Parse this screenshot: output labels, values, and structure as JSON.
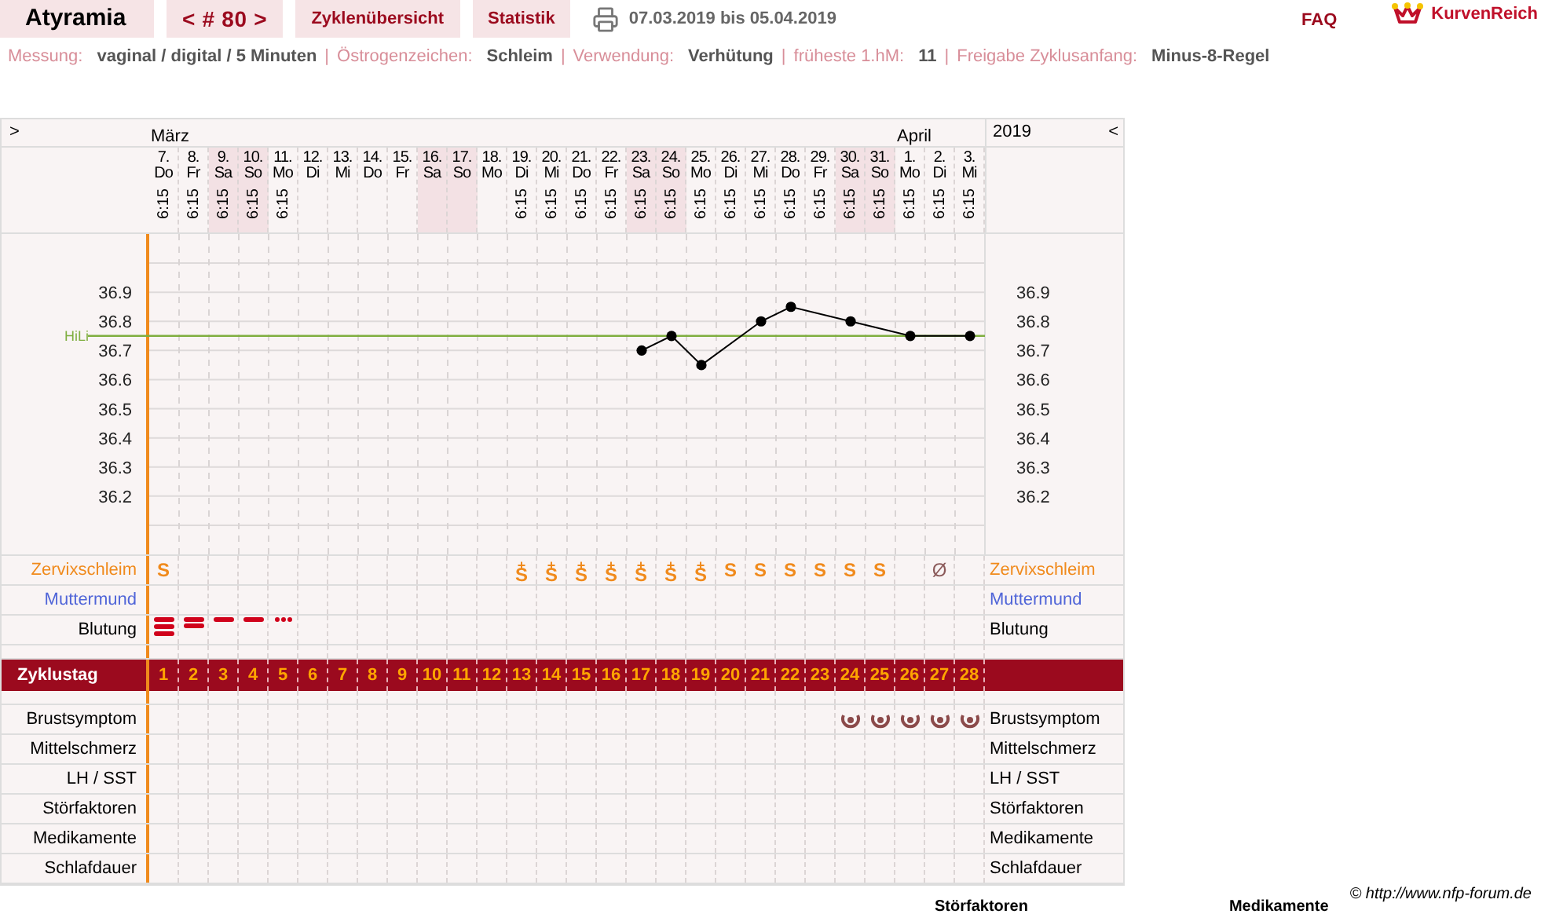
{
  "topbar": {
    "tabs": [
      {
        "label": "Atyramia",
        "kind": "title"
      },
      {
        "label": "< # 80 >",
        "kind": "nav"
      },
      {
        "label": "Zyklenübersicht",
        "kind": "link"
      },
      {
        "label": "Statistik",
        "kind": "link"
      }
    ],
    "date_range": "07.03.2019 bis 05.04.2019",
    "faq": "FAQ",
    "logo": "KurvenReich"
  },
  "info": [
    {
      "label": "Messung:",
      "value": "vaginal / digital / 5 Minuten"
    },
    {
      "separator": "|",
      "label": "Östrogenzeichen:",
      "value": "Schleim"
    },
    {
      "separator": "|",
      "label": "Verwendung:",
      "value": "Verhütung"
    },
    {
      "separator": "|",
      "label": "früheste 1.hM:",
      "value": "11"
    },
    {
      "separator": "|",
      "label": "Freigabe Zyklusanfang:",
      "value": "Minus-8-Regel"
    }
  ],
  "grid": {
    "expand_left": ">",
    "collapse_right": "<",
    "year": "2019",
    "days": [
      {
        "date": "7.",
        "weekday": "Do",
        "month": "März",
        "time": "6:15",
        "weekend": false,
        "cycle_day": "1",
        "mucus": "S",
        "bleeding": {
          "kind": "heavy"
        },
        "breast": false
      },
      {
        "date": "8.",
        "weekday": "Fr",
        "time": "6:15",
        "weekend": false,
        "cycle_day": "2",
        "bleeding": {
          "kind": "strong"
        },
        "breast": false
      },
      {
        "date": "9.",
        "weekday": "Sa",
        "time": "6:15",
        "weekend": true,
        "cycle_day": "3",
        "bleeding": {
          "kind": "medium"
        },
        "breast": false
      },
      {
        "date": "10.",
        "weekday": "So",
        "time": "6:15",
        "weekend": true,
        "cycle_day": "4",
        "bleeding": {
          "kind": "medium"
        },
        "breast": false
      },
      {
        "date": "11.",
        "weekday": "Mo",
        "time": "6:15",
        "weekend": false,
        "cycle_day": "5",
        "bleeding": {
          "kind": "spotting"
        },
        "breast": false
      },
      {
        "date": "12.",
        "weekday": "Di",
        "weekend": false,
        "cycle_day": "6",
        "breast": false
      },
      {
        "date": "13.",
        "weekday": "Mi",
        "weekend": false,
        "cycle_day": "7",
        "breast": false
      },
      {
        "date": "14.",
        "weekday": "Do",
        "weekend": false,
        "cycle_day": "8",
        "breast": false
      },
      {
        "date": "15.",
        "weekday": "Fr",
        "weekend": false,
        "cycle_day": "9",
        "breast": false
      },
      {
        "date": "16.",
        "weekday": "Sa",
        "weekend": true,
        "cycle_day": "10",
        "breast": false
      },
      {
        "date": "17.",
        "weekday": "So",
        "weekend": true,
        "cycle_day": "11",
        "breast": false
      },
      {
        "date": "18.",
        "weekday": "Mo",
        "weekend": false,
        "cycle_day": "12",
        "breast": false
      },
      {
        "date": "19.",
        "weekday": "Di",
        "time": "6:15",
        "weekend": false,
        "cycle_day": "13",
        "mucus": "S",
        "mucus_plus": "+",
        "breast": false
      },
      {
        "date": "20.",
        "weekday": "Mi",
        "time": "6:15",
        "weekend": false,
        "cycle_day": "14",
        "mucus": "S",
        "mucus_plus": "+",
        "breast": false
      },
      {
        "date": "21.",
        "weekday": "Do",
        "time": "6:15",
        "weekend": false,
        "cycle_day": "15",
        "mucus": "S",
        "mucus_plus": "+",
        "breast": false
      },
      {
        "date": "22.",
        "weekday": "Fr",
        "time": "6:15",
        "weekend": false,
        "cycle_day": "16",
        "mucus": "S",
        "mucus_plus": "+",
        "breast": false
      },
      {
        "date": "23.",
        "weekday": "Sa",
        "time": "6:15",
        "weekend": true,
        "cycle_day": "17",
        "mucus": "S",
        "mucus_plus": "+",
        "breast": false
      },
      {
        "date": "24.",
        "weekday": "So",
        "time": "6:15",
        "weekend": true,
        "cycle_day": "18",
        "mucus": "S",
        "mucus_plus": "+",
        "breast": false
      },
      {
        "date": "25.",
        "weekday": "Mo",
        "time": "6:15",
        "weekend": false,
        "cycle_day": "19",
        "mucus": "S",
        "mucus_plus": "+",
        "breast": false
      },
      {
        "date": "26.",
        "weekday": "Di",
        "time": "6:15",
        "weekend": false,
        "cycle_day": "20",
        "mucus": "S",
        "breast": false
      },
      {
        "date": "27.",
        "weekday": "Mi",
        "time": "6:15",
        "weekend": false,
        "cycle_day": "21",
        "mucus": "S",
        "breast": false
      },
      {
        "date": "28.",
        "weekday": "Do",
        "time": "6:15",
        "weekend": false,
        "cycle_day": "22",
        "mucus": "S",
        "breast": false
      },
      {
        "date": "29.",
        "weekday": "Fr",
        "time": "6:15",
        "weekend": false,
        "cycle_day": "23",
        "mucus": "S",
        "breast": false
      },
      {
        "date": "30.",
        "weekday": "Sa",
        "time": "6:15",
        "weekend": true,
        "cycle_day": "24",
        "mucus": "S",
        "breast": true
      },
      {
        "date": "31.",
        "weekday": "So",
        "time": "6:15",
        "weekend": true,
        "cycle_day": "25",
        "mucus": "S",
        "breast": true
      },
      {
        "date": "1.",
        "weekday": "Mo",
        "month": "April",
        "time": "6:15",
        "weekend": false,
        "cycle_day": "26",
        "breast": true
      },
      {
        "date": "2.",
        "weekday": "Di",
        "time": "6:15",
        "weekend": false,
        "cycle_day": "27",
        "mucus": "Ø",
        "breast": true
      },
      {
        "date": "3.",
        "weekday": "Mi",
        "time": "6:15",
        "weekend": false,
        "cycle_day": "28",
        "breast": true
      }
    ],
    "chart_data": {
      "type": "line",
      "grid": true,
      "series": [
        {
          "color": "#000000",
          "marker": "o",
          "values": [
            null,
            null,
            null,
            null,
            null,
            null,
            null,
            null,
            null,
            null,
            null,
            null,
            null,
            null,
            null,
            null,
            36.7,
            36.75,
            36.65,
            null,
            36.8,
            36.85,
            null,
            36.8,
            null,
            36.75,
            null,
            36.75
          ]
        }
      ],
      "ylim": [
        36.0,
        37.1
      ],
      "yticks": [
        36.2,
        36.3,
        36.4,
        36.5,
        36.6,
        36.7,
        36.8,
        36.9
      ],
      "ref_lines": [
        {
          "axis": "y",
          "value": 36.75,
          "label": "HiLi",
          "color": "#7fae3f"
        }
      ]
    },
    "right_scale": [
      "36.9",
      "36.8",
      "36.7",
      "36.6",
      "36.5",
      "36.4",
      "36.3",
      "36.2"
    ],
    "rows": [
      {
        "kind": "mucus",
        "label": "Zervixschleim",
        "label_right": "Zervixschleim"
      },
      {
        "kind": "cervix",
        "label": "Muttermund",
        "label_right": "Muttermund"
      },
      {
        "kind": "bleeding",
        "label": "Blutung",
        "label_right": "Blutung"
      },
      {
        "kind": "spacer"
      },
      {
        "kind": "cycle",
        "label": "Zyklustag"
      },
      {
        "kind": "spacer"
      },
      {
        "kind": "breast",
        "label": "Brustsymptom",
        "label_right": "Brustsymptom"
      },
      {
        "kind": "plain",
        "label": "Mittelschmerz",
        "label_right": "Mittelschmerz"
      },
      {
        "kind": "plain",
        "label": "LH / SST",
        "label_right": "LH / SST"
      },
      {
        "kind": "plain",
        "label": "Störfaktoren",
        "label_right": "Störfaktoren"
      },
      {
        "kind": "plain",
        "label": "Medikamente",
        "label_right": "Medikamente"
      },
      {
        "kind": "plain",
        "label": "Schlafdauer",
        "label_right": "Schlafdauer"
      }
    ]
  },
  "copyright": "© http://www.nfp-forum.de",
  "below_headings": [
    "Störfaktoren",
    "Medikamente"
  ]
}
